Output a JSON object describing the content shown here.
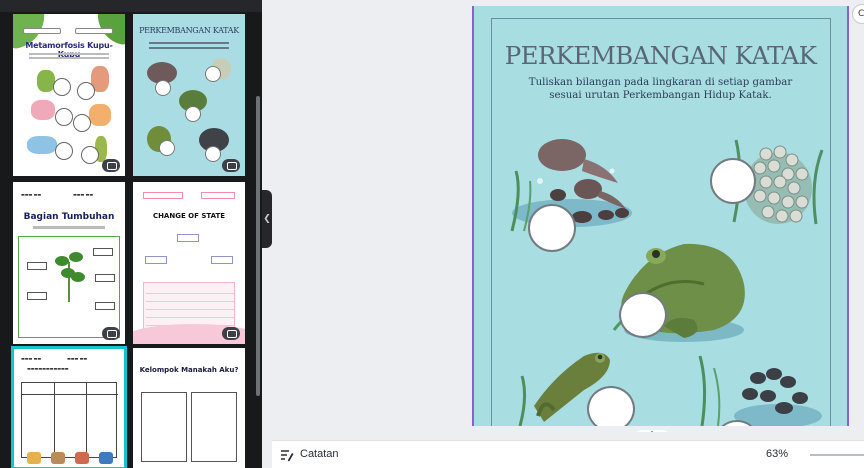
{
  "canvas": {
    "title": "PERKEMBANGAN KATAK",
    "instruction_line1": "Tuliskan bilangan pada lingkaran di setiap gambar",
    "instruction_line2": "sesuai urutan Perkembangan Hidup Katak."
  },
  "templates": [
    {
      "title": "Metamorfosis Kupu-Kupu"
    },
    {
      "title": "PERKEMBANGAN KATAK"
    },
    {
      "title": "Bagian Tumbuhan"
    },
    {
      "title": "CHANGE OF STATE"
    },
    {
      "title": ""
    },
    {
      "title": "Kelompok Manakah Aku?"
    }
  ],
  "bottombar": {
    "notes_label": "Catatan",
    "zoom_level": "63%"
  },
  "icons": {
    "notes": "notes-icon",
    "premium": "crown-badge-icon",
    "collapse": "chevron-left-icon"
  },
  "colors": {
    "page_background": "#a8dde2",
    "selection_outline": "#13c5d1",
    "page_border": "#8b5fd1",
    "panel_background": "#18191b"
  }
}
